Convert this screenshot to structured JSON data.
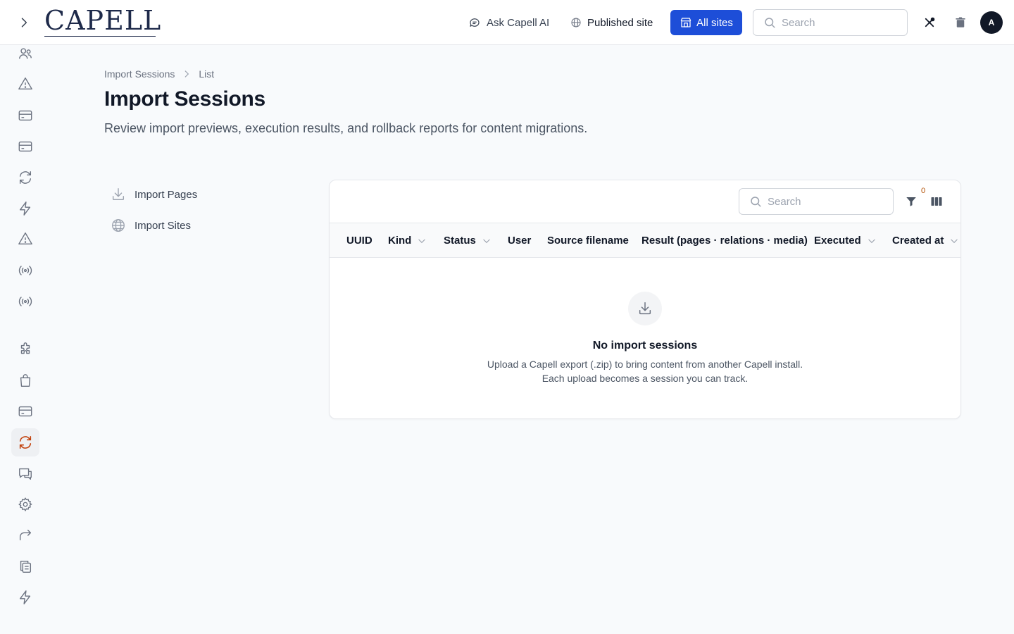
{
  "app": {
    "logo_text": "CAPELL"
  },
  "topbar": {
    "ask_ai_label": "Ask Capell AI",
    "published_site_label": "Published site",
    "all_sites_label": "All sites",
    "search_placeholder": "Search",
    "avatar_initial": "A",
    "accent_color": "#1d4ed8"
  },
  "sidebar": {
    "items": [
      {
        "icon": "users-icon",
        "active": false
      },
      {
        "icon": "warning-icon",
        "active": false
      },
      {
        "icon": "credit-card-icon",
        "active": false
      },
      {
        "icon": "credit-card-icon",
        "active": false
      },
      {
        "icon": "refresh-icon",
        "active": false
      },
      {
        "icon": "lightning-icon",
        "active": false
      },
      {
        "icon": "warning-icon",
        "active": false
      },
      {
        "icon": "broadcast-icon",
        "active": false
      },
      {
        "icon": "broadcast-icon",
        "active": false
      },
      {
        "icon": "puzzle-icon",
        "active": false
      },
      {
        "icon": "shopping-bag-icon",
        "active": false
      },
      {
        "icon": "credit-card-icon",
        "active": false
      },
      {
        "icon": "refresh-icon",
        "active": true
      },
      {
        "icon": "chat-icon",
        "active": false
      },
      {
        "icon": "gear-icon",
        "active": false
      },
      {
        "icon": "redirect-icon",
        "active": false
      },
      {
        "icon": "copy-icon",
        "active": false
      },
      {
        "icon": "lightning-icon",
        "active": false
      }
    ],
    "active_color": "#c2410c"
  },
  "breadcrumb": {
    "parent": "Import Sessions",
    "current": "List"
  },
  "page": {
    "title": "Import Sessions",
    "description": "Review import previews, execution results, and rollback reports for content migrations."
  },
  "subnav": {
    "items": [
      {
        "label": "Import Pages",
        "icon": "download-icon"
      },
      {
        "label": "Import Sites",
        "icon": "globe-icon"
      }
    ]
  },
  "table": {
    "search_placeholder": "Search",
    "filter_count": "0",
    "columns": [
      {
        "label": "UUID",
        "sortable": false
      },
      {
        "label": "Kind",
        "sortable": true
      },
      {
        "label": "Status",
        "sortable": true
      },
      {
        "label": "User",
        "sortable": false
      },
      {
        "label": "Source filename",
        "sortable": false
      },
      {
        "label": "Result (pages · relations · media)",
        "sortable": false
      },
      {
        "label": "Executed",
        "sortable": true
      },
      {
        "label": "Created at",
        "sortable": true
      }
    ],
    "empty": {
      "title": "No import sessions",
      "line1": "Upload a Capell export (.zip) to bring content from another Capell install.",
      "line2": "Each upload becomes a session you can track."
    }
  }
}
